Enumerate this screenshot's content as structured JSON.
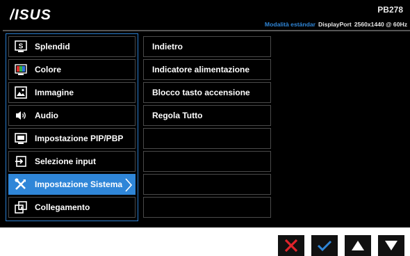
{
  "header": {
    "logo": "/ISUS",
    "model": "PB278",
    "mode_label": "Modalità estándar",
    "input": "DisplayPort",
    "resolution": "2560x1440 @ 60Hz"
  },
  "main_menu": [
    {
      "label": "Splendid",
      "icon": "splendid-icon"
    },
    {
      "label": "Colore",
      "icon": "color-icon"
    },
    {
      "label": "Immagine",
      "icon": "image-icon"
    },
    {
      "label": "Audio",
      "icon": "speaker-icon"
    },
    {
      "label": "Impostazione PIP/PBP",
      "icon": "pip-icon"
    },
    {
      "label": "Selezione input",
      "icon": "input-icon"
    },
    {
      "label": "Impostazione Sistema",
      "icon": "tools-icon",
      "selected": true
    },
    {
      "label": "Collegamento",
      "icon": "shortcut-icon"
    }
  ],
  "submenu": [
    "Indietro",
    "Indicatore alimentazione",
    "Blocco tasto accensione",
    "Regola Tutto",
    "",
    "",
    "",
    ""
  ],
  "keys": [
    {
      "icon": "close-icon",
      "color": "#e0242b"
    },
    {
      "icon": "check-icon",
      "color": "#2f86d8"
    },
    {
      "icon": "arrow-up-icon",
      "color": "#ffffff"
    },
    {
      "icon": "arrow-down-icon",
      "color": "#ffffff"
    }
  ],
  "colors": {
    "accent": "#2f86d8",
    "background": "#000000",
    "border": "#4a4a4a"
  }
}
